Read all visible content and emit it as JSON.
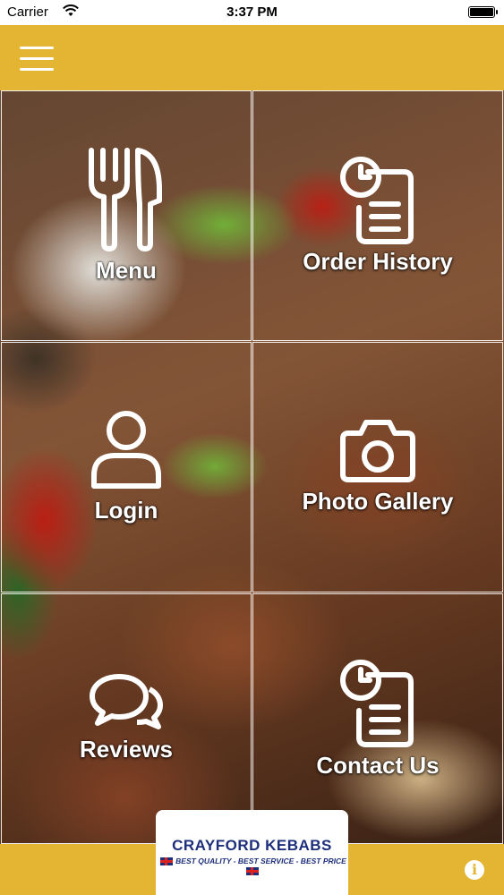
{
  "status_bar": {
    "carrier": "Carrier",
    "time": "3:37 PM"
  },
  "header": {
    "menu_icon": "hamburger-icon",
    "color": "#e4b532"
  },
  "tiles": [
    {
      "label": "Menu",
      "icon": "cutlery-icon"
    },
    {
      "label": "Order History",
      "icon": "order-history-icon"
    },
    {
      "label": "Login",
      "icon": "user-icon"
    },
    {
      "label": "Photo Gallery",
      "icon": "camera-icon"
    },
    {
      "label": "Reviews",
      "icon": "chat-bubbles-icon"
    },
    {
      "label": "Contact Us",
      "icon": "contact-clipboard-icon"
    }
  ],
  "brand": {
    "name": "CRAYFORD KEBABS",
    "tagline": "BEST QUALITY - BEST SERVICE - BEST PRICE"
  },
  "footer": {
    "info_icon": "info-icon",
    "info_glyph": "i"
  }
}
